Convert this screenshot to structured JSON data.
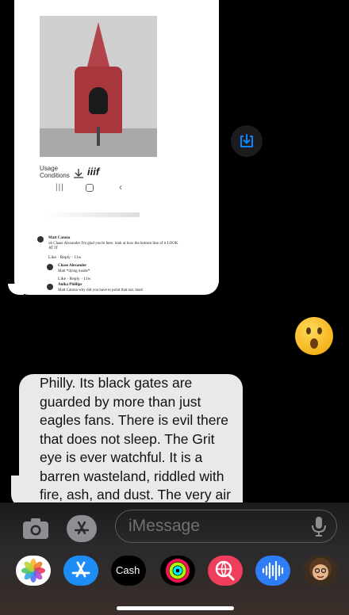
{
  "shot": {
    "usage_label": "Usage\nConditions",
    "iiif_label": "iiif",
    "comments": [
      {
        "name": "Matt Catona",
        "text": "oh Chase Alexander I'm glad you're here. look at how the bottom line of it LOOK AT IT",
        "meta": "Like · Reply · 11w"
      },
      {
        "name": "Chase Alexander",
        "text": "Matt *dying inside*",
        "meta": "Like · Reply · 11w"
      },
      {
        "name": "Anika Phillips",
        "text": "Matt Catona why did you have to point that out. man!",
        "meta": ""
      }
    ]
  },
  "message": {
    "text": "Philly. Its black gates are\nguarded by more than just\neagles fans. There is evil there\nthat does not sleep. The Grit\neye is ever watchful. It is a\nbarren wasteland, riddled with\nfire, ash, and dust. The very air\nyou breathe is a poisonous"
  },
  "compose": {
    "placeholder": "iMessage"
  },
  "apps": [
    {
      "name": "photos",
      "label": ""
    },
    {
      "name": "app-store",
      "label": ""
    },
    {
      "name": "apple-cash",
      "label": "Cash"
    },
    {
      "name": "activity",
      "label": ""
    },
    {
      "name": "search-images",
      "label": ""
    },
    {
      "name": "audio-message",
      "label": ""
    },
    {
      "name": "memoji",
      "label": ""
    }
  ],
  "colors": {
    "accent": "#0a84ff",
    "bubble": "#e9e9eb",
    "background": "#000000"
  }
}
